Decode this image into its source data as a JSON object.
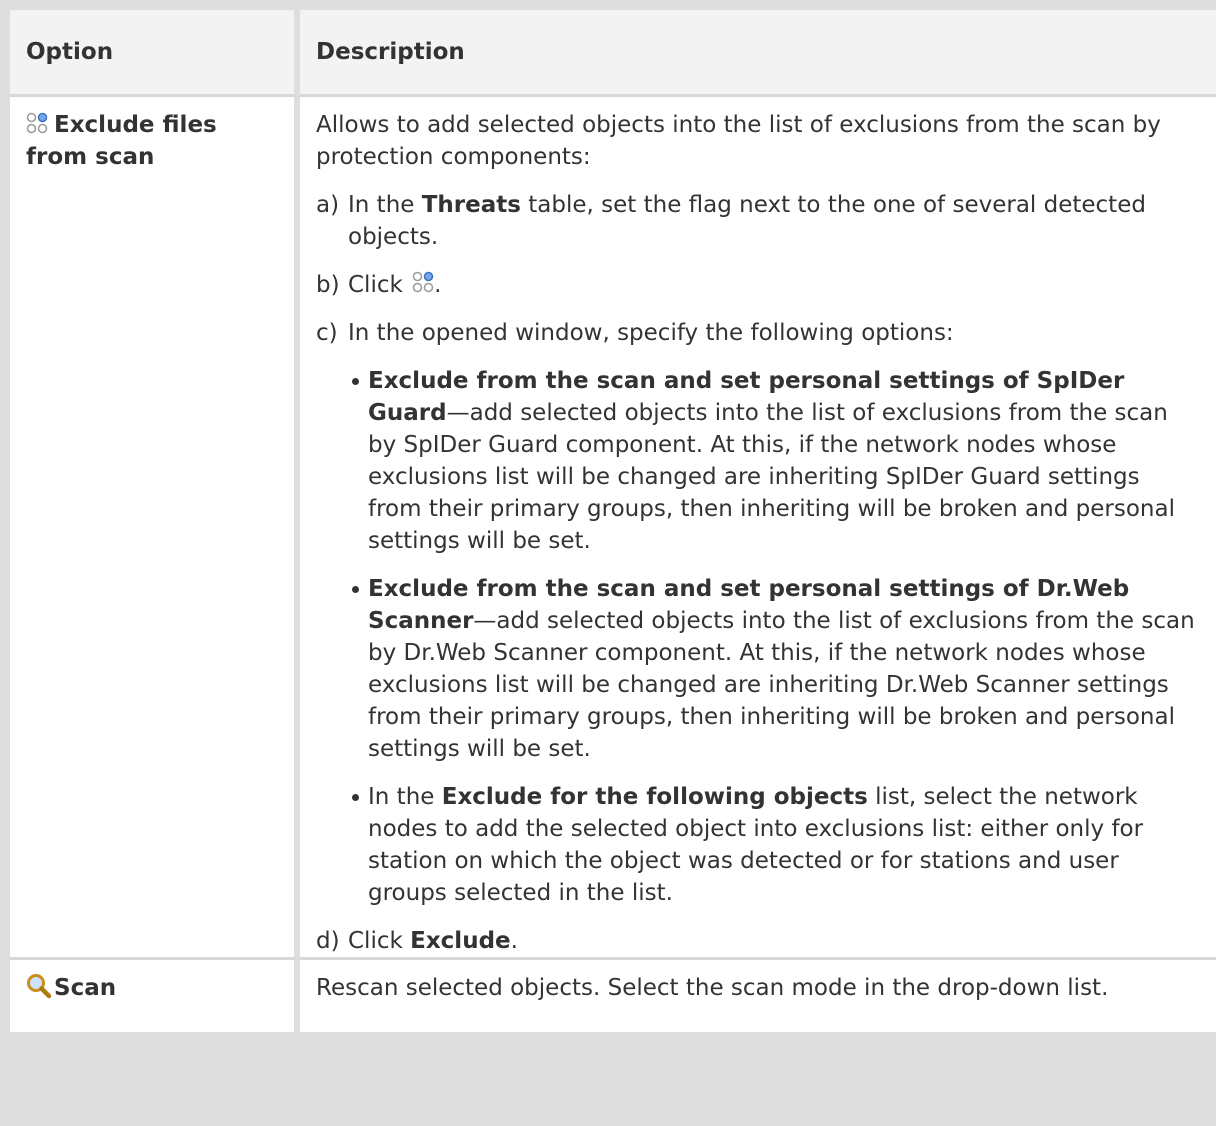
{
  "table": {
    "headers": [
      "Option",
      "Description"
    ],
    "row1": {
      "option_label": "Exclude files from scan",
      "option_icon": "exclude-dots-icon",
      "intro": "Allows to add selected objects into the list of exclusions from the scan by protection components:",
      "step_a": {
        "label": "a)",
        "prefix": "In the ",
        "bold": "Threats",
        "suffix": " table, set the flag next to the one of several detected objects."
      },
      "step_b": {
        "label": "b)",
        "prefix": "Click ",
        "suffix": "."
      },
      "step_c": {
        "label": "c)",
        "text": "In the opened window, specify the following options:"
      },
      "bullets": [
        {
          "bold": "Exclude from the scan and set personal settings of SpIDer Guard",
          "text": "—add selected objects into the list of exclusions from the scan by SpIDer Guard component. At this, if the network nodes whose exclusions list will be changed are inheriting SpIDer Guard settings from their primary groups, then inheriting will be broken and personal settings will be set."
        },
        {
          "bold": "Exclude from the scan and set personal settings of Dr.Web Scanner",
          "text": "—add selected objects into the list of exclusions from the scan by Dr.Web Scanner component. At this, if the network nodes whose exclusions list will be changed are inheriting Dr.Web Scanner settings from their primary groups, then inheriting will be broken and personal settings will be set."
        },
        {
          "prefix": "In the ",
          "bold": "Exclude for the following objects",
          "text": " list, select the network nodes to add the selected object into exclusions list: either only for station on which the object was detected or for stations and user groups selected in the list."
        }
      ],
      "step_d": {
        "label": "d)",
        "prefix": "Click ",
        "bold": "Exclude",
        "suffix": "."
      }
    },
    "row2": {
      "option_label": "Scan",
      "option_icon": "magnifier-icon",
      "description": "Rescan selected objects. Select the scan mode in the drop-down list."
    }
  },
  "colors": {
    "frame": "#dedede",
    "header_bg": "#f3f3f3",
    "text": "#333333",
    "icon_blue": "#5b8fd6",
    "icon_gray": "#9a9a9a",
    "magnifier_gold": "#d9a520"
  }
}
